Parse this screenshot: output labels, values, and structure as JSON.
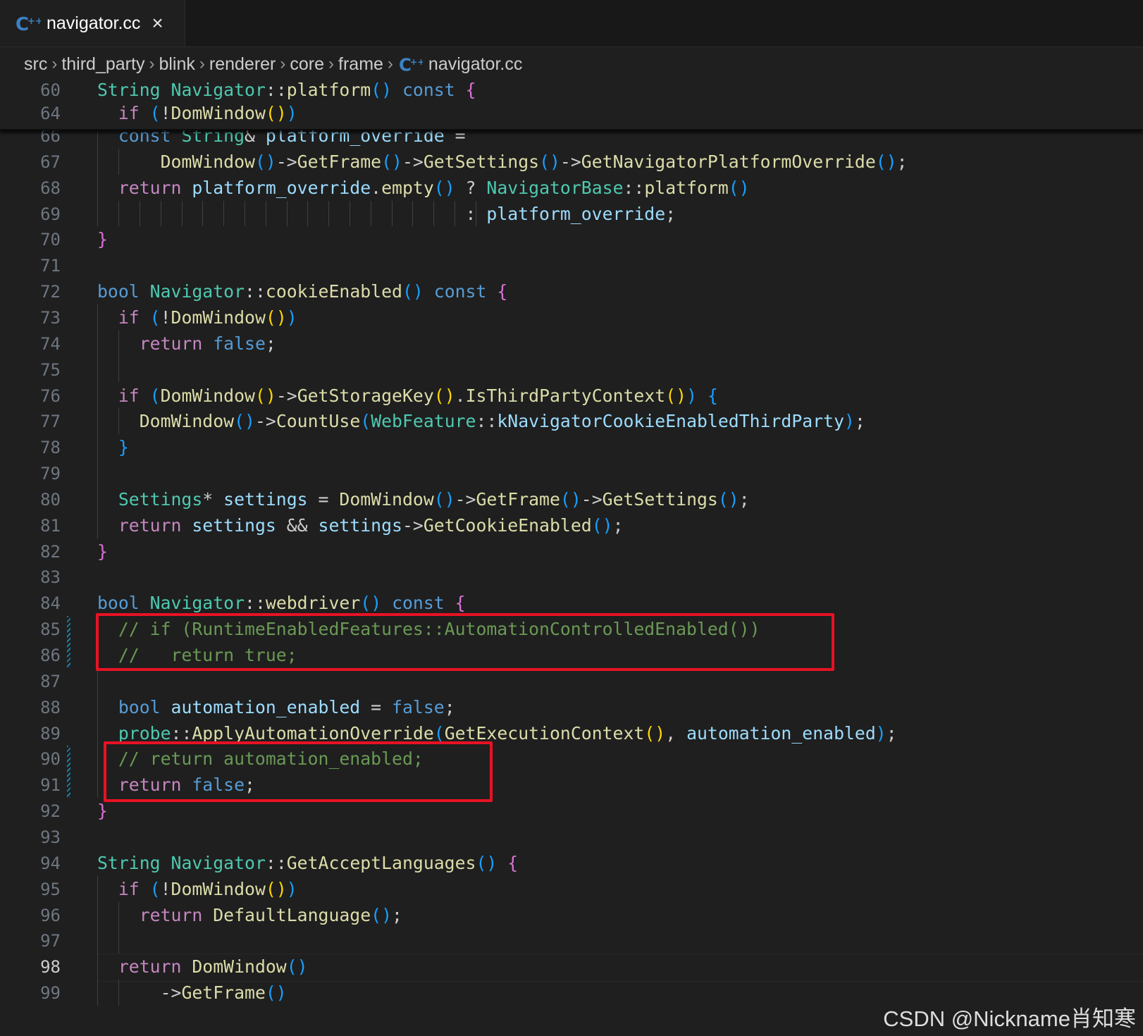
{
  "tab": {
    "label": "navigator.cc",
    "close": "×"
  },
  "breadcrumb": [
    "src",
    "third_party",
    "blink",
    "renderer",
    "core",
    "frame",
    "navigator.cc"
  ],
  "breadcrumb_separator": "›",
  "watermark": "CSDN @Nickname肖知寒",
  "colors": {
    "accent_modified": "#1b81a8",
    "highlight_box": "#e81224",
    "background": "#1f1f1f"
  },
  "sticky_lines": [
    {
      "n": "60",
      "tokens": [
        [
          "ty",
          "String"
        ],
        [
          "t",
          " "
        ],
        [
          "ty",
          "Navigator"
        ],
        [
          "t",
          "::"
        ],
        [
          "fn",
          "platform"
        ],
        [
          "p3",
          "()"
        ],
        [
          "t",
          " "
        ],
        [
          "kw",
          "const"
        ],
        [
          "t",
          " "
        ],
        [
          "p2",
          "{"
        ]
      ]
    },
    {
      "n": "64",
      "tokens": [
        [
          "t",
          "  "
        ],
        [
          "ct",
          "if"
        ],
        [
          "t",
          " "
        ],
        [
          "p3",
          "("
        ],
        [
          "t",
          "!"
        ],
        [
          "fn",
          "DomWindow"
        ],
        [
          "p1",
          "()"
        ],
        [
          "p3",
          ")"
        ]
      ]
    }
  ],
  "lines": [
    {
      "n": "66",
      "tokens": [
        [
          "t",
          "  "
        ],
        [
          "kw",
          "const"
        ],
        [
          "t",
          " "
        ],
        [
          "ty",
          "String"
        ],
        [
          "t",
          "& "
        ],
        [
          "vr",
          "platform_override"
        ],
        [
          "t",
          " ="
        ]
      ]
    },
    {
      "n": "67",
      "tokens": [
        [
          "t",
          "      "
        ],
        [
          "fn",
          "DomWindow"
        ],
        [
          "p3",
          "()"
        ],
        [
          "t",
          "->"
        ],
        [
          "fn",
          "GetFrame"
        ],
        [
          "p3",
          "()"
        ],
        [
          "t",
          "->"
        ],
        [
          "fn",
          "GetSettings"
        ],
        [
          "p3",
          "()"
        ],
        [
          "t",
          "->"
        ],
        [
          "fn",
          "GetNavigatorPlatformOverride"
        ],
        [
          "p3",
          "()"
        ],
        [
          "t",
          ";"
        ]
      ]
    },
    {
      "n": "68",
      "tokens": [
        [
          "t",
          "  "
        ],
        [
          "ct",
          "return"
        ],
        [
          "t",
          " "
        ],
        [
          "vr",
          "platform_override"
        ],
        [
          "t",
          "."
        ],
        [
          "fn",
          "empty"
        ],
        [
          "p3",
          "()"
        ],
        [
          "t",
          " ? "
        ],
        [
          "ty",
          "NavigatorBase"
        ],
        [
          "t",
          "::"
        ],
        [
          "fn",
          "platform"
        ],
        [
          "p3",
          "()"
        ]
      ]
    },
    {
      "n": "69",
      "tokens": [
        [
          "t",
          "                                   : "
        ],
        [
          "vr",
          "platform_override"
        ],
        [
          "t",
          ";"
        ]
      ]
    },
    {
      "n": "70",
      "tokens": [
        [
          "p2",
          "}"
        ]
      ]
    },
    {
      "n": "71",
      "tokens": []
    },
    {
      "n": "72",
      "tokens": [
        [
          "kw",
          "bool"
        ],
        [
          "t",
          " "
        ],
        [
          "ty",
          "Navigator"
        ],
        [
          "t",
          "::"
        ],
        [
          "fn",
          "cookieEnabled"
        ],
        [
          "p3",
          "()"
        ],
        [
          "t",
          " "
        ],
        [
          "kw",
          "const"
        ],
        [
          "t",
          " "
        ],
        [
          "p2",
          "{"
        ]
      ]
    },
    {
      "n": "73",
      "tokens": [
        [
          "t",
          "  "
        ],
        [
          "ct",
          "if"
        ],
        [
          "t",
          " "
        ],
        [
          "p3",
          "("
        ],
        [
          "t",
          "!"
        ],
        [
          "fn",
          "DomWindow"
        ],
        [
          "p1",
          "()"
        ],
        [
          "p3",
          ")"
        ]
      ]
    },
    {
      "n": "74",
      "tokens": [
        [
          "t",
          "    "
        ],
        [
          "ct",
          "return"
        ],
        [
          "t",
          " "
        ],
        [
          "kw",
          "false"
        ],
        [
          "t",
          ";"
        ]
      ]
    },
    {
      "n": "75",
      "tokens": []
    },
    {
      "n": "76",
      "tokens": [
        [
          "t",
          "  "
        ],
        [
          "ct",
          "if"
        ],
        [
          "t",
          " "
        ],
        [
          "p3",
          "("
        ],
        [
          "fn",
          "DomWindow"
        ],
        [
          "p1",
          "()"
        ],
        [
          "t",
          "->"
        ],
        [
          "fn",
          "GetStorageKey"
        ],
        [
          "p1",
          "()"
        ],
        [
          "t",
          "."
        ],
        [
          "fn",
          "IsThirdPartyContext"
        ],
        [
          "p1",
          "()"
        ],
        [
          "p3",
          ")"
        ],
        [
          "t",
          " "
        ],
        [
          "p3",
          "{"
        ]
      ]
    },
    {
      "n": "77",
      "tokens": [
        [
          "t",
          "    "
        ],
        [
          "fn",
          "DomWindow"
        ],
        [
          "p3",
          "()"
        ],
        [
          "t",
          "->"
        ],
        [
          "fn",
          "CountUse"
        ],
        [
          "p3",
          "("
        ],
        [
          "ty",
          "WebFeature"
        ],
        [
          "t",
          "::"
        ],
        [
          "vr",
          "kNavigatorCookieEnabledThirdParty"
        ],
        [
          "p3",
          ")"
        ],
        [
          "t",
          ";"
        ]
      ]
    },
    {
      "n": "78",
      "tokens": [
        [
          "t",
          "  "
        ],
        [
          "p3",
          "}"
        ]
      ]
    },
    {
      "n": "79",
      "tokens": []
    },
    {
      "n": "80",
      "tokens": [
        [
          "t",
          "  "
        ],
        [
          "ty",
          "Settings"
        ],
        [
          "t",
          "* "
        ],
        [
          "vr",
          "settings"
        ],
        [
          "t",
          " = "
        ],
        [
          "fn",
          "DomWindow"
        ],
        [
          "p3",
          "()"
        ],
        [
          "t",
          "->"
        ],
        [
          "fn",
          "GetFrame"
        ],
        [
          "p3",
          "()"
        ],
        [
          "t",
          "->"
        ],
        [
          "fn",
          "GetSettings"
        ],
        [
          "p3",
          "()"
        ],
        [
          "t",
          ";"
        ]
      ]
    },
    {
      "n": "81",
      "tokens": [
        [
          "t",
          "  "
        ],
        [
          "ct",
          "return"
        ],
        [
          "t",
          " "
        ],
        [
          "vr",
          "settings"
        ],
        [
          "t",
          " && "
        ],
        [
          "vr",
          "settings"
        ],
        [
          "t",
          "->"
        ],
        [
          "fn",
          "GetCookieEnabled"
        ],
        [
          "p3",
          "()"
        ],
        [
          "t",
          ";"
        ]
      ]
    },
    {
      "n": "82",
      "tokens": [
        [
          "p2",
          "}"
        ]
      ]
    },
    {
      "n": "83",
      "tokens": []
    },
    {
      "n": "84",
      "tokens": [
        [
          "kw",
          "bool"
        ],
        [
          "t",
          " "
        ],
        [
          "ty",
          "Navigator"
        ],
        [
          "t",
          "::"
        ],
        [
          "fn",
          "webdriver"
        ],
        [
          "p3",
          "()"
        ],
        [
          "t",
          " "
        ],
        [
          "kw",
          "const"
        ],
        [
          "t",
          " "
        ],
        [
          "p2",
          "{"
        ]
      ]
    },
    {
      "n": "85",
      "tokens": [
        [
          "t",
          "  "
        ],
        [
          "cm",
          "// if (RuntimeEnabledFeatures::AutomationControlledEnabled())"
        ]
      ]
    },
    {
      "n": "86",
      "tokens": [
        [
          "t",
          "  "
        ],
        [
          "cm",
          "//   return true;"
        ]
      ]
    },
    {
      "n": "87",
      "tokens": []
    },
    {
      "n": "88",
      "tokens": [
        [
          "t",
          "  "
        ],
        [
          "kw",
          "bool"
        ],
        [
          "t",
          " "
        ],
        [
          "vr",
          "automation_enabled"
        ],
        [
          "t",
          " = "
        ],
        [
          "kw",
          "false"
        ],
        [
          "t",
          ";"
        ]
      ]
    },
    {
      "n": "89",
      "tokens": [
        [
          "t",
          "  "
        ],
        [
          "ty",
          "probe"
        ],
        [
          "t",
          "::"
        ],
        [
          "fn",
          "ApplyAutomationOverride"
        ],
        [
          "p3",
          "("
        ],
        [
          "fn",
          "GetExecutionContext"
        ],
        [
          "p1",
          "()"
        ],
        [
          "t",
          ", "
        ],
        [
          "vr",
          "automation_enabled"
        ],
        [
          "p3",
          ")"
        ],
        [
          "t",
          ";"
        ]
      ]
    },
    {
      "n": "90",
      "tokens": [
        [
          "t",
          "  "
        ],
        [
          "cm",
          "// return automation_enabled;"
        ]
      ]
    },
    {
      "n": "91",
      "tokens": [
        [
          "t",
          "  "
        ],
        [
          "ct",
          "return"
        ],
        [
          "t",
          " "
        ],
        [
          "kw",
          "false"
        ],
        [
          "t",
          ";"
        ]
      ]
    },
    {
      "n": "92",
      "tokens": [
        [
          "p2",
          "}"
        ]
      ]
    },
    {
      "n": "93",
      "tokens": []
    },
    {
      "n": "94",
      "tokens": [
        [
          "ty",
          "String"
        ],
        [
          "t",
          " "
        ],
        [
          "ty",
          "Navigator"
        ],
        [
          "t",
          "::"
        ],
        [
          "fn",
          "GetAcceptLanguages"
        ],
        [
          "p3",
          "()"
        ],
        [
          "t",
          " "
        ],
        [
          "p2",
          "{"
        ]
      ]
    },
    {
      "n": "95",
      "tokens": [
        [
          "t",
          "  "
        ],
        [
          "ct",
          "if"
        ],
        [
          "t",
          " "
        ],
        [
          "p3",
          "("
        ],
        [
          "t",
          "!"
        ],
        [
          "fn",
          "DomWindow"
        ],
        [
          "p1",
          "()"
        ],
        [
          "p3",
          ")"
        ]
      ]
    },
    {
      "n": "96",
      "tokens": [
        [
          "t",
          "    "
        ],
        [
          "ct",
          "return"
        ],
        [
          "t",
          " "
        ],
        [
          "fn",
          "DefaultLanguage"
        ],
        [
          "p3",
          "()"
        ],
        [
          "t",
          ";"
        ]
      ]
    },
    {
      "n": "97",
      "tokens": []
    },
    {
      "n": "98",
      "tokens": [
        [
          "t",
          "  "
        ],
        [
          "ct",
          "return"
        ],
        [
          "t",
          " "
        ],
        [
          "fn",
          "DomWindow"
        ],
        [
          "p3",
          "()"
        ]
      ]
    },
    {
      "n": "99",
      "tokens": [
        [
          "t",
          "      ->"
        ],
        [
          "fn",
          "GetFrame"
        ],
        [
          "p3",
          "()"
        ]
      ]
    }
  ]
}
